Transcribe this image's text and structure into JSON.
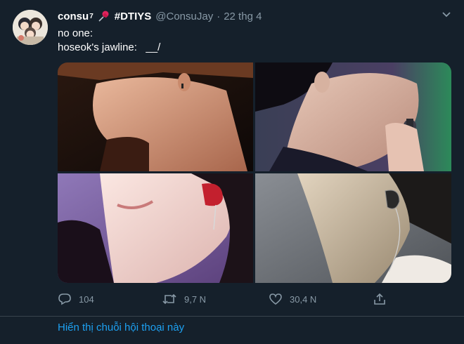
{
  "tweet": {
    "display_name": "consu",
    "name_superscript": "7",
    "hashtag": "#DTIYS",
    "handle": "@ConsuJay",
    "separator": "·",
    "date": "22 thg 4",
    "lines": [
      "no one:",
      "hoseok's jawline:   __/"
    ],
    "icons": {
      "pin": "pushpin-icon",
      "menu": "chevron-down-icon"
    },
    "accent": "#1da1f2"
  },
  "actions": {
    "reply_count": "104",
    "retweet_count": "9,7 N",
    "like_count": "30,4 N"
  },
  "thread": {
    "link_label": "Hiển thị chuỗi hội thoại này"
  }
}
